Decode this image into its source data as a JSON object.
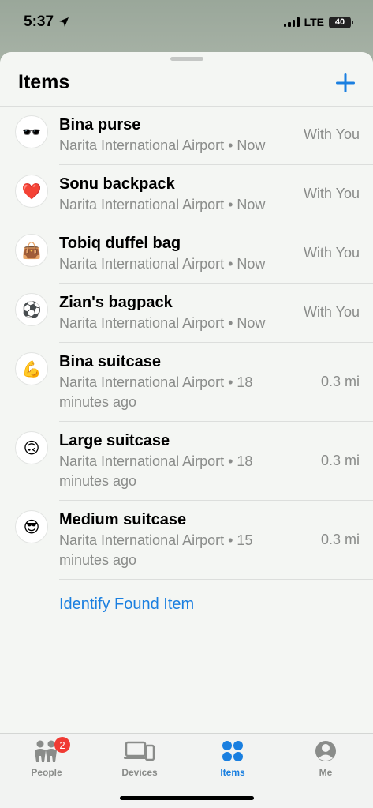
{
  "status_bar": {
    "time": "5:37",
    "network": "LTE",
    "battery": "40"
  },
  "header": {
    "title": "Items"
  },
  "items": [
    {
      "emoji": "🕶️",
      "icon": "sunglasses-icon",
      "name": "Bina purse",
      "location": "Narita International Airport • Now",
      "status": "With You"
    },
    {
      "emoji": "❤️",
      "icon": "heart-icon",
      "name": "Sonu backpack",
      "location": "Narita International Airport • Now",
      "status": "With You"
    },
    {
      "emoji": "👜",
      "icon": "handbag-icon",
      "name": "Tobiq duffel bag",
      "location": "Narita International Airport • Now",
      "status": "With You"
    },
    {
      "emoji": "⚽",
      "icon": "soccer-ball-icon",
      "name": "Zian's bagpack",
      "location": "Narita International Airport • Now",
      "status": "With You"
    },
    {
      "emoji": "💪",
      "icon": "flexed-biceps-icon",
      "name": "Bina suitcase",
      "location": "Narita International Airport • 18 minutes ago",
      "status": "0.3 mi"
    },
    {
      "emoji": "🙃",
      "icon": "upside-down-face-icon",
      "name": "Large suitcase",
      "location": "Narita International Airport • 18 minutes ago",
      "status": "0.3 mi"
    },
    {
      "emoji": "😎",
      "icon": "sunglasses-face-icon",
      "name": "Medium suitcase",
      "location": "Narita International Airport • 15 minutes ago",
      "status": "0.3 mi"
    }
  ],
  "identify_link": "Identify Found Item",
  "tabbar": {
    "tabs": [
      {
        "label": "People",
        "icon": "people-icon",
        "badge": "2"
      },
      {
        "label": "Devices",
        "icon": "devices-icon"
      },
      {
        "label": "Items",
        "icon": "items-icon",
        "active": true
      },
      {
        "label": "Me",
        "icon": "me-icon"
      }
    ]
  },
  "colors": {
    "accent": "#1a7fe0",
    "badge": "#f03a33"
  }
}
